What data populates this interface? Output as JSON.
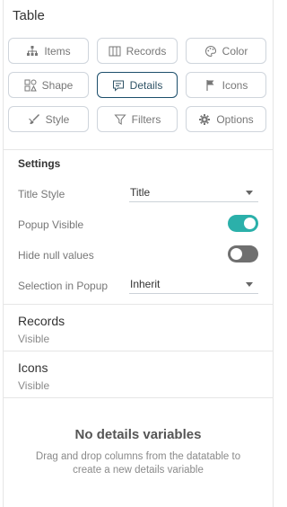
{
  "panel": {
    "title": "Table"
  },
  "buttons": {
    "items": "Items",
    "records": "Records",
    "color": "Color",
    "shape": "Shape",
    "details": "Details",
    "icons": "Icons",
    "style": "Style",
    "filters": "Filters",
    "options": "Options",
    "active": "Details"
  },
  "settings": {
    "heading": "Settings",
    "title_style_label": "Title Style",
    "title_style_value": "Title",
    "popup_visible_label": "Popup Visible",
    "popup_visible_on": true,
    "hide_null_label": "Hide null values",
    "hide_null_on": false,
    "selection_label": "Selection in Popup",
    "selection_value": "Inherit"
  },
  "records": {
    "heading": "Records",
    "status": "Visible"
  },
  "icons_section": {
    "heading": "Icons",
    "status": "Visible"
  },
  "empty": {
    "title": "No details variables",
    "description": "Drag and drop columns from the datatable to create a new details variable"
  },
  "colors": {
    "accent": "#2bb0aa",
    "active_border": "#1c4e6b",
    "toggle_off": "#6f6f6f"
  }
}
